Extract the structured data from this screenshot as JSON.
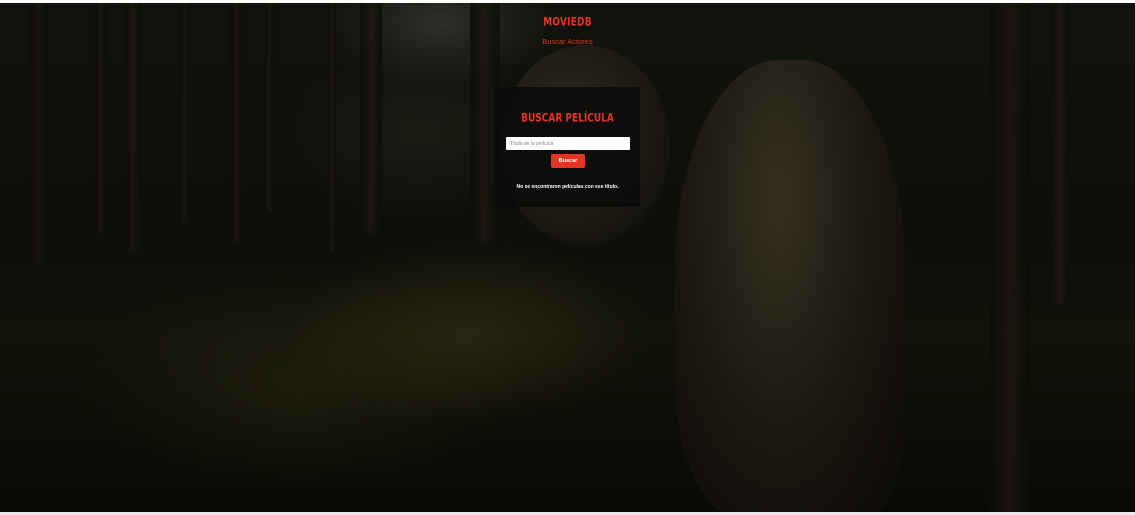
{
  "header": {
    "brand": "MOVIEDB",
    "nav_link": "Buscar Actores"
  },
  "search": {
    "title": "BUSCAR PELÍCULA",
    "placeholder": "Título de la película",
    "value": "",
    "button_label": "Buscar",
    "message": "No se encontraron películas con ese título."
  },
  "colors": {
    "accent": "#e53424",
    "panel_bg": "#0a0a0a",
    "text": "#ffffff"
  }
}
